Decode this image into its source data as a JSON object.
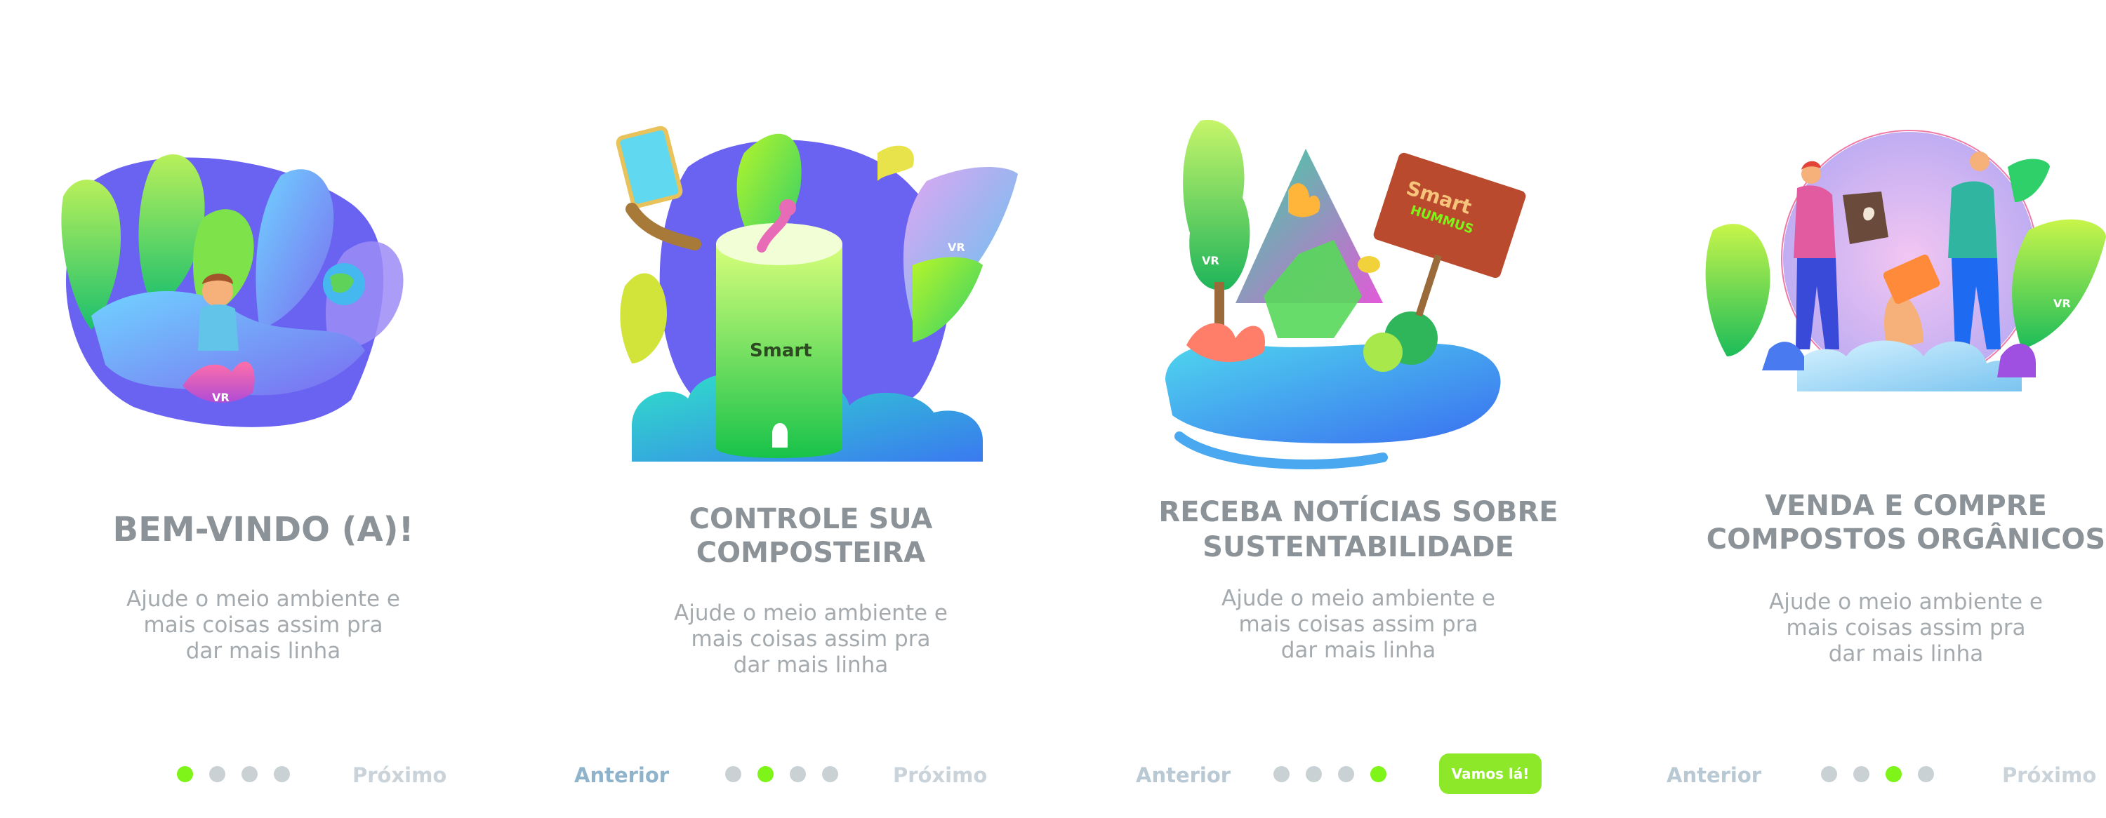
{
  "screens": [
    {
      "title_lines": [
        "BEM-VINDO (A)!"
      ],
      "desc_lines": [
        "Ajude o meio ambiente e",
        "mais coisas assim pra",
        "dar mais linha"
      ],
      "next_label": "Próximo",
      "active_dot": 1
    },
    {
      "title_lines": [
        "CONTROLE SUA",
        "COMPOSTEIRA"
      ],
      "desc_lines": [
        "Ajude o meio ambiente e",
        "mais coisas assim pra",
        "dar mais linha"
      ],
      "prev_label": "Anterior",
      "next_label": "Próximo",
      "active_dot": 2
    },
    {
      "title_lines": [
        "RECEBA NOTÍCIAS SOBRE",
        "SUSTENTABILIDADE"
      ],
      "desc_lines": [
        "Ajude o meio ambiente e",
        "mais coisas assim pra",
        "dar mais linha"
      ],
      "prev_label": "Anterior",
      "cta_label": "Vamos lá!",
      "active_dot": 4
    },
    {
      "title_lines": [
        "VENDA E COMPRE",
        "COMPOSTOS ORGÂNICOS"
      ],
      "desc_lines": [
        "Ajude o meio ambiente e",
        "mais coisas assim pra",
        "dar mais linha"
      ],
      "prev_label": "Anterior",
      "next_label": "Próximo",
      "active_dot": 3
    }
  ],
  "illustration_text": {
    "brand_mark": "VR",
    "bin_logo": "Smart",
    "sign_line1": "Smart",
    "sign_line2": "HUMMUS"
  },
  "colors": {
    "accent_green": "#7ef418",
    "cta_green": "#8de82a",
    "title_gray": "#8c9398",
    "text_gray": "#a4aaae",
    "dot_gray": "#c9d1d5",
    "nav_gray": "#c9d3d9",
    "nav_blue": "#8fb3cb"
  }
}
